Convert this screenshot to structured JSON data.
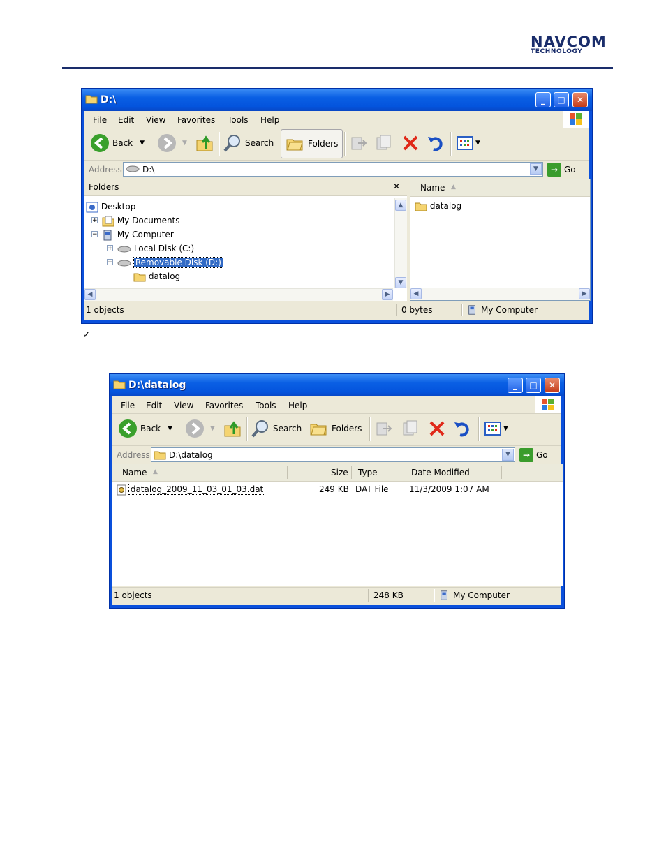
{
  "logo": {
    "line1": "NAVCOM",
    "line2": "TECHNOLOGY"
  },
  "check_mark": "✓",
  "window1": {
    "title": "D:\\",
    "menu": [
      "File",
      "Edit",
      "View",
      "Favorites",
      "Tools",
      "Help"
    ],
    "toolbar": {
      "back": "Back",
      "search": "Search",
      "folders": "Folders"
    },
    "address": {
      "label": "Address",
      "value": "D:\\",
      "go": "Go"
    },
    "folders_pane": {
      "title": "Folders",
      "close": "✕",
      "tree": [
        {
          "label": "Desktop",
          "icon": "desktop-icon"
        },
        {
          "label": "My Documents",
          "icon": "documents-icon",
          "expander": "+"
        },
        {
          "label": "My Computer",
          "icon": "computer-icon",
          "expander": "−"
        },
        {
          "label": "Local Disk (C:)",
          "icon": "drive-icon",
          "expander": "+"
        },
        {
          "label": "Removable Disk (D:)",
          "icon": "drive-icon",
          "expander": "−",
          "selected": true
        },
        {
          "label": "datalog",
          "icon": "folder-icon"
        }
      ]
    },
    "list_pane": {
      "column": "Name",
      "items": [
        "datalog"
      ]
    },
    "status": {
      "objects": "1 objects",
      "size": "0 bytes",
      "location": "My Computer"
    }
  },
  "window2": {
    "title": "D:\\datalog",
    "menu": [
      "File",
      "Edit",
      "View",
      "Favorites",
      "Tools",
      "Help"
    ],
    "toolbar": {
      "back": "Back",
      "search": "Search",
      "folders": "Folders"
    },
    "address": {
      "label": "Address",
      "value": "D:\\datalog",
      "go": "Go"
    },
    "columns": [
      "Name",
      "Size",
      "Type",
      "Date Modified"
    ],
    "rows": [
      {
        "name": "datalog_2009_11_03_01_03.dat",
        "size": "249 KB",
        "type": "DAT File",
        "modified": "11/3/2009 1:07 AM"
      }
    ],
    "status": {
      "objects": "1 objects",
      "size": "248 KB",
      "location": "My Computer"
    }
  }
}
